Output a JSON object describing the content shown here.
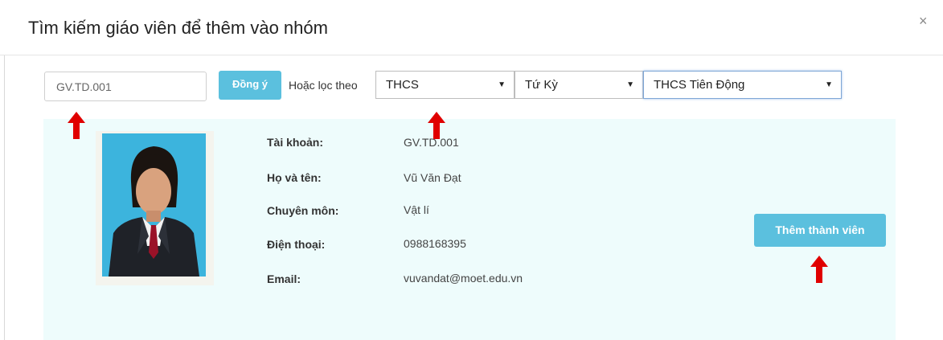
{
  "dialog": {
    "title": "Tìm kiếm giáo viên để thêm vào nhóm",
    "close_glyph": "×"
  },
  "search": {
    "value": "GV.TD.001",
    "submit_label": "Đồng ý"
  },
  "filter": {
    "label": "Hoặc lọc theo",
    "level": "THCS",
    "district": "Tứ Kỳ",
    "school": "THCS Tiên Động",
    "caret_glyph": "▼"
  },
  "teacher": {
    "fields": [
      {
        "label": "Tài khoản:",
        "value": "GV.TD.001"
      },
      {
        "label": "Họ và tên:",
        "value": "Vũ Văn Đạt"
      },
      {
        "label": "Chuyên môn:",
        "value": "Vật lí"
      },
      {
        "label": "Điện thoại:",
        "value": "0988168395"
      },
      {
        "label": "Email:",
        "value": "vuvandat@moet.edu.vn"
      }
    ],
    "add_button_label": "Thêm thành viên"
  },
  "colors": {
    "accent_button": "#5bc0de",
    "card_background": "#eefcfc",
    "annotation_arrow": "#e00000"
  },
  "icons": {
    "close": "close-icon",
    "dropdown": "chevron-down-icon",
    "annotation": "arrow-up-icon"
  }
}
